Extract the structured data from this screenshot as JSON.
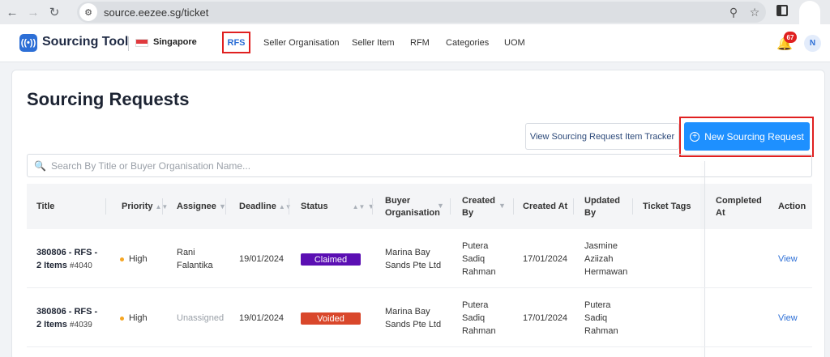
{
  "browser": {
    "url": "source.eezee.sg/ticket"
  },
  "header": {
    "app_title": "Sourcing Tool",
    "country": "Singapore",
    "nav": [
      "RFS",
      "Seller Organisation",
      "Seller Item",
      "RFM",
      "Categories",
      "UOM"
    ],
    "active_nav": "RFS",
    "notification_count": "67",
    "avatar_initial": "N"
  },
  "page": {
    "title": "Sourcing Requests",
    "tracker_button": "View Sourcing Request Item Tracker",
    "new_button": "New Sourcing Request",
    "search_placeholder": "Search By Title or Buyer Organisation Name..."
  },
  "table": {
    "columns": {
      "title": "Title",
      "priority": "Priority",
      "assignee": "Assignee",
      "deadline": "Deadline",
      "status": "Status",
      "buyer_org_1": "Buyer",
      "buyer_org_2": "Organisation",
      "created_by_1": "Created",
      "created_by_2": "By",
      "created_at": "Created At",
      "updated_by_1": "Updated",
      "updated_by_2": "By",
      "ticket_tags": "Ticket Tags",
      "completed_at_1": "Completed",
      "completed_at_2": "At",
      "action": "Action"
    },
    "rows": [
      {
        "title_1": "380806 - RFS -",
        "title_2": "2 Items",
        "ticket_id": "#4040",
        "priority": "High",
        "assignee_1": "Rani",
        "assignee_2": "Falantika",
        "deadline": "19/01/2024",
        "status": "Claimed",
        "buyer_1": "Marina Bay",
        "buyer_2": "Sands Pte Ltd",
        "created_by_1": "Putera",
        "created_by_2": "Sadiq",
        "created_by_3": "Rahman",
        "created_at": "17/01/2024",
        "updated_by_1": "Jasmine",
        "updated_by_2": "Aziizah",
        "updated_by_3": "Hermawan",
        "action": "View"
      },
      {
        "title_1": "380806 - RFS -",
        "title_2": "2 Items",
        "ticket_id": "#4039",
        "priority": "High",
        "assignee_1": "Unassigned",
        "assignee_2": "",
        "deadline": "19/01/2024",
        "status": "Voided",
        "buyer_1": "Marina Bay",
        "buyer_2": "Sands Pte Ltd",
        "created_by_1": "Putera",
        "created_by_2": "Sadiq",
        "created_by_3": "Rahman",
        "created_at": "17/01/2024",
        "updated_by_1": "Putera",
        "updated_by_2": "Sadiq",
        "updated_by_3": "Rahman",
        "action": "View"
      }
    ]
  },
  "colors": {
    "claimed": "#5b0fb3",
    "voided": "#d9472b",
    "primary": "#1e90ff",
    "highlight": "#e02020",
    "priority_high": "#f5a623"
  }
}
